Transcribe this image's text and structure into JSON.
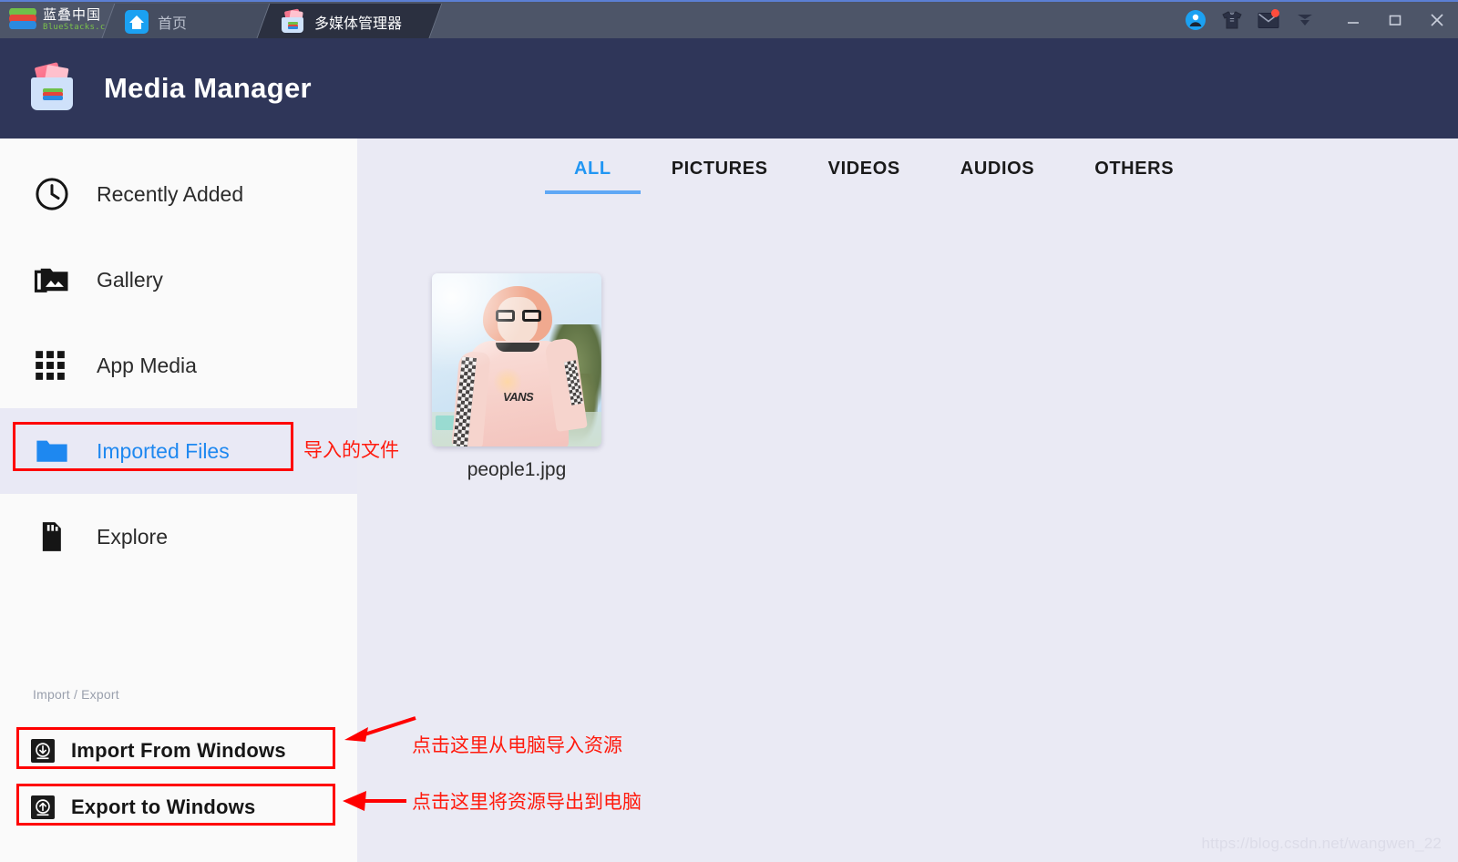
{
  "titlebar": {
    "brand_cn": "蓝叠中国",
    "brand_en": "BlueStacks.cn",
    "brand_logo_icon": "bluestacks-logo-icon",
    "tabs": [
      {
        "label": "首页",
        "icon": "home-icon",
        "active": false
      },
      {
        "label": "多媒体管理器",
        "icon": "media-manager-icon",
        "active": true
      }
    ],
    "right_icons": [
      {
        "name": "account-avatar-icon"
      },
      {
        "name": "tshirt-icon"
      },
      {
        "name": "mail-icon",
        "badge": true
      },
      {
        "name": "chevron-down-icon"
      }
    ],
    "window_controls": [
      {
        "name": "minimize-button",
        "glyph": "—"
      },
      {
        "name": "maximize-button",
        "glyph": "▢"
      },
      {
        "name": "close-button",
        "glyph": "✕"
      }
    ]
  },
  "header": {
    "title": "Media Manager",
    "icon": "media-manager-app-icon",
    "background_color": "#2f3659"
  },
  "sidebar": {
    "items": [
      {
        "label": "Recently Added",
        "icon": "clock-icon",
        "active": false
      },
      {
        "label": "Gallery",
        "icon": "photo-library-icon",
        "active": false
      },
      {
        "label": "App Media",
        "icon": "apps-grid-icon",
        "active": false
      },
      {
        "label": "Imported Files",
        "icon": "folder-icon",
        "active": true
      },
      {
        "label": "Explore",
        "icon": "sd-card-icon",
        "active": false
      }
    ],
    "section_label": "Import / Export",
    "io_buttons": [
      {
        "label": "Import From Windows",
        "icon": "download-arrow-icon"
      },
      {
        "label": "Export to Windows",
        "icon": "upload-arrow-icon"
      }
    ],
    "active_color": "#1e88f0",
    "active_row_bg": "#e9e9f5"
  },
  "content": {
    "tabs": [
      {
        "label": "ALL",
        "active": true
      },
      {
        "label": "PICTURES",
        "active": false
      },
      {
        "label": "VIDEOS",
        "active": false
      },
      {
        "label": "AUDIOS",
        "active": false
      },
      {
        "label": "OTHERS",
        "active": false
      }
    ],
    "tab_active_color": "#2196f3",
    "files": [
      {
        "name": "people1.jpg",
        "thumbnail": "photo-thumbnail-people1"
      }
    ],
    "background_color": "#eaeaf4"
  },
  "annotations": {
    "color": "#ff0000",
    "items": [
      {
        "name": "imported-files-callout",
        "text": "导入的文件"
      },
      {
        "name": "import-from-windows-callout",
        "text": "点击这里从电脑导入资源"
      },
      {
        "name": "export-to-windows-callout",
        "text": "点击这里将资源导出到电脑"
      }
    ]
  },
  "watermark": {
    "text": "https://blog.csdn.net/wangwen_22"
  }
}
